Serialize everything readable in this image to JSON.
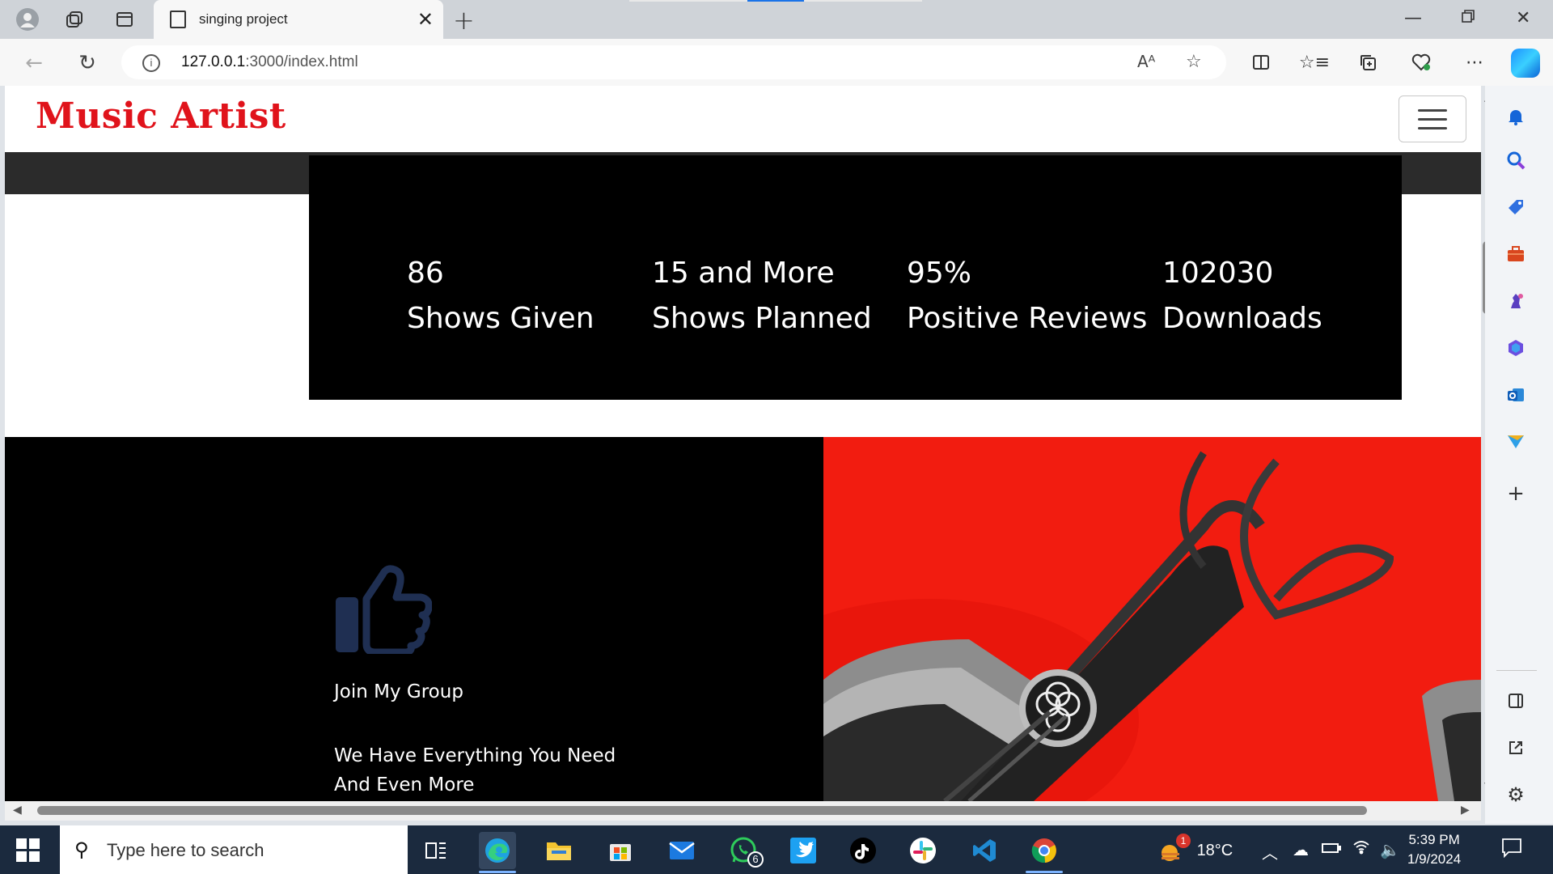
{
  "browser": {
    "tab_title": "singing project",
    "url_host": "127.0.0.1",
    "url_path": ":3000/index.html",
    "read_aloud_label": "Aᴬ"
  },
  "site": {
    "brand": "Music Artist",
    "colors": {
      "brand": "#e0131b",
      "stats_bg": "#000000",
      "band_bg": "#2b2b2b",
      "thumb_icon": "#1f2f52",
      "photo_bg": "#f2190f"
    },
    "stats": [
      {
        "value": "86",
        "label": "Shows Given"
      },
      {
        "value": "15 and More",
        "label": "Shows Planned"
      },
      {
        "value": "95%",
        "label": "Positive Reviews"
      },
      {
        "value": "102030",
        "label": "Downloads"
      }
    ],
    "feature": {
      "icon": "thumbs-up-icon",
      "heading": "Join My Group",
      "line1": "We Have Everything You Need",
      "line2": "And Even More"
    }
  },
  "taskbar": {
    "search_placeholder": "Type here to search",
    "whatsapp_badge": "6",
    "weather_badge": "1",
    "temperature": "18°C",
    "time": "5:39 PM",
    "date": "1/9/2024"
  }
}
